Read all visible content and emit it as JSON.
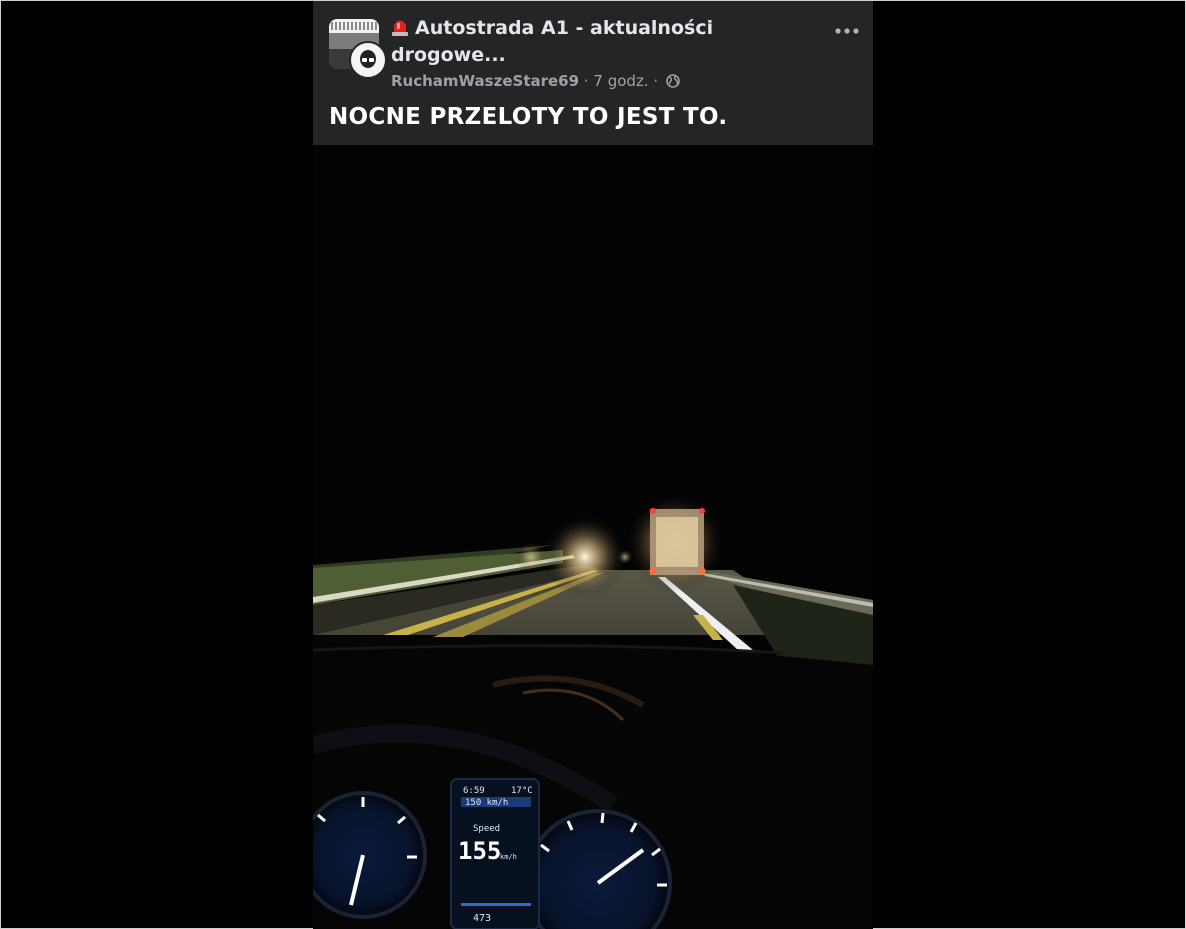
{
  "post": {
    "group_name": "Autostrada A1 - aktualności drogowe...",
    "author": "RuchamWaszeStare69",
    "time": "7 godz.",
    "separator": "·",
    "privacy_icon": "globe-icon",
    "more_icon": "more-options-icon",
    "text": "NOCNE PRZELOTY TO JEST TO."
  },
  "video": {
    "dashboard": {
      "time": "6:59",
      "temperature": "17°C",
      "limiter": "150 km/h",
      "speed_label": "Speed",
      "speed": "155",
      "speed_unit": "km/h",
      "range": "473"
    }
  },
  "colors": {
    "header_bg": "#242526",
    "text_primary": "#e4e6eb",
    "text_secondary": "#9ea2a8",
    "accent_red": "#e02424"
  }
}
